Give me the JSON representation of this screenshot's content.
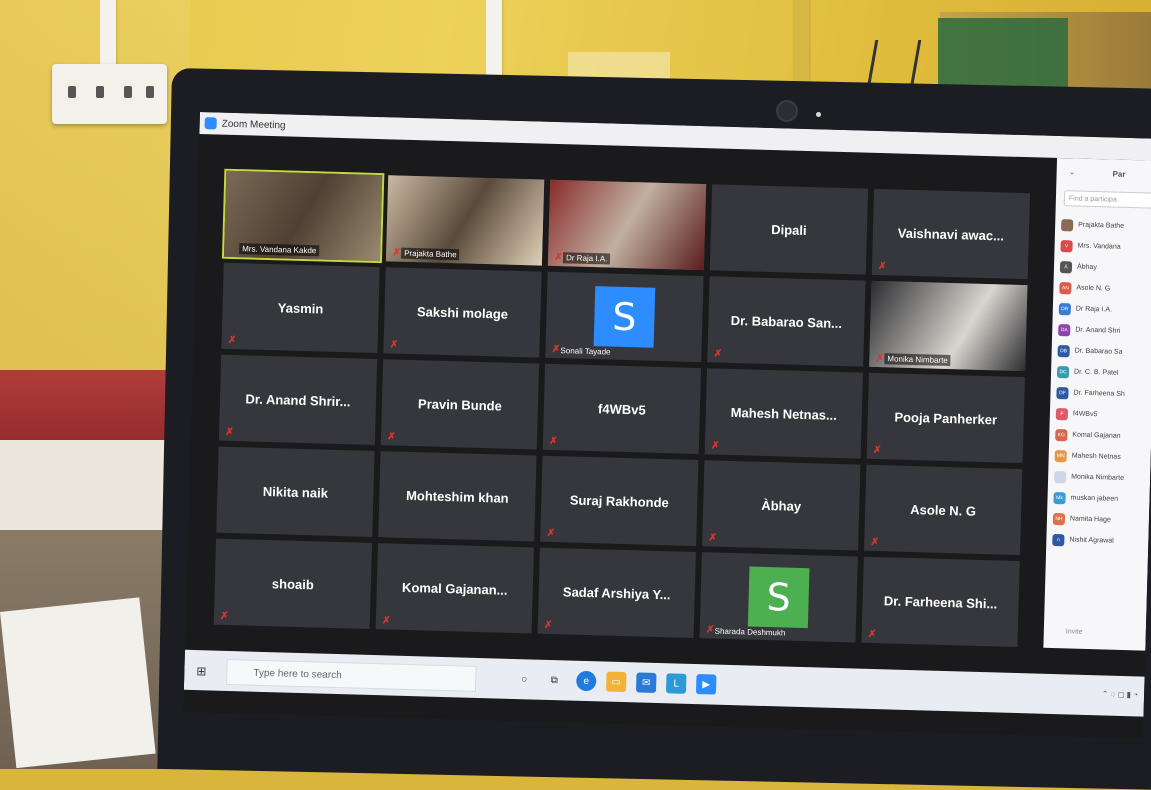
{
  "window": {
    "title": "Zoom Meeting"
  },
  "panel": {
    "header": "Par",
    "search_placeholder": "Find a participa",
    "invite_label": "Invite",
    "participants": [
      {
        "initials": "",
        "name": "Prajakta Bathe",
        "color": "#8a6a55"
      },
      {
        "initials": "V",
        "name": "Mrs. Vandana",
        "color": "#d94a4a"
      },
      {
        "initials": "À",
        "name": "Àbhay",
        "color": "#555555"
      },
      {
        "initials": "AN",
        "name": "Asole N. G",
        "color": "#d95b4a"
      },
      {
        "initials": "DR",
        "name": "Dr Raja I.A.",
        "color": "#3a7bd5"
      },
      {
        "initials": "DA",
        "name": "Dr. Anand Shri",
        "color": "#8e44ad"
      },
      {
        "initials": "DB",
        "name": "Dr. Babarao Sa",
        "color": "#2c5aa0"
      },
      {
        "initials": "DC",
        "name": "Dr. C. B. Patel",
        "color": "#3a9bb0"
      },
      {
        "initials": "DF",
        "name": "Dr. Farheena Sh",
        "color": "#2c5aa0"
      },
      {
        "initials": "F",
        "name": "f4WBv5",
        "color": "#e05a6a"
      },
      {
        "initials": "KG",
        "name": "Komal Gajanan",
        "color": "#d9654a"
      },
      {
        "initials": "MN",
        "name": "Mahesh Netnas",
        "color": "#e09a4a"
      },
      {
        "initials": "",
        "name": "Monika Nimbarte",
        "color": "#cfd6e6"
      },
      {
        "initials": "Mk",
        "name": "muskan jabeen",
        "color": "#3a9bd5"
      },
      {
        "initials": "NH",
        "name": "Namita Hage",
        "color": "#e0704a"
      },
      {
        "initials": "n",
        "name": "Nishit Agrawal",
        "color": "#2c5aa0"
      }
    ]
  },
  "tiles": [
    {
      "name": "Mrs. Vandana Kakde",
      "type": "video",
      "active": true,
      "muted": false
    },
    {
      "name": "Prajakta Bathe",
      "type": "video",
      "active": false,
      "muted": true
    },
    {
      "name": "Dr Raja I.A.",
      "type": "video",
      "active": false,
      "muted": true
    },
    {
      "name": "Dipali",
      "type": "name",
      "muted": false
    },
    {
      "name": "Vaishnavi  awac...",
      "type": "name",
      "muted": true
    },
    {
      "name": "Yasmin",
      "type": "name",
      "muted": true
    },
    {
      "name": "Sakshi molage",
      "type": "name",
      "muted": true
    },
    {
      "name": "Sonali Tayade",
      "type": "avatar",
      "letter": "S",
      "color": "#2d8cff",
      "muted": true
    },
    {
      "name": "Dr. Babarao San...",
      "type": "name",
      "muted": true
    },
    {
      "name": "Monika Nimbarte",
      "type": "video",
      "muted": true
    },
    {
      "name": "Dr. Anand Shrir...",
      "type": "name",
      "muted": true
    },
    {
      "name": "Pravin Bunde",
      "type": "name",
      "muted": true
    },
    {
      "name": "f4WBv5",
      "type": "name",
      "muted": true
    },
    {
      "name": "Mahesh  Netnas...",
      "type": "name",
      "muted": true
    },
    {
      "name": "Pooja Panherker",
      "type": "name",
      "muted": true
    },
    {
      "name": "Nikita naik",
      "type": "name",
      "muted": false
    },
    {
      "name": "Mohteshim khan",
      "type": "name",
      "muted": false
    },
    {
      "name": "Suraj Rakhonde",
      "type": "name",
      "muted": true
    },
    {
      "name": "Àbhay",
      "type": "name",
      "muted": true
    },
    {
      "name": "Asole N. G",
      "type": "name",
      "muted": true
    },
    {
      "name": "shoaib",
      "type": "name",
      "muted": true
    },
    {
      "name": "Komal  Gajanan...",
      "type": "name",
      "muted": true
    },
    {
      "name": "Sadaf Arshiya Y...",
      "type": "name",
      "muted": true
    },
    {
      "name": "Sharada Deshmukh",
      "type": "avatar",
      "letter": "S",
      "color": "#4caf50",
      "muted": true
    },
    {
      "name": "Dr. Farheena Shi...",
      "type": "name",
      "muted": true
    }
  ],
  "taskbar": {
    "search_placeholder": "Type here to search"
  }
}
